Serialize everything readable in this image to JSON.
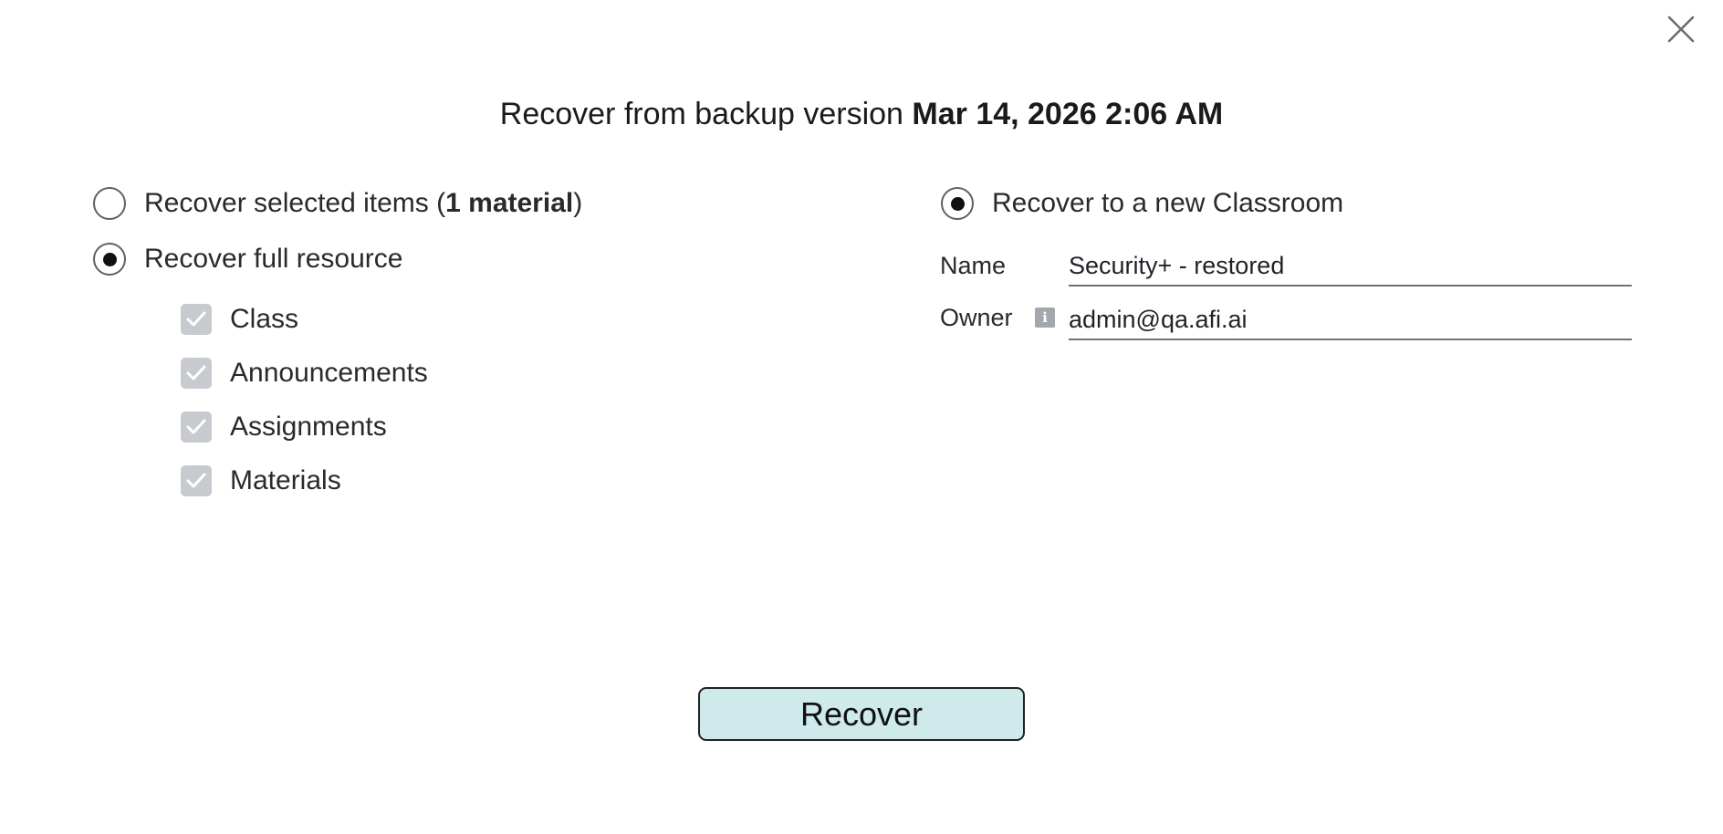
{
  "dialog": {
    "title_prefix": "Recover from backup version ",
    "title_date": "Mar 14, 2026 2:06 AM",
    "close_icon": "close-icon"
  },
  "scope": {
    "selected_items": {
      "label_prefix": "Recover selected items (",
      "label_bold": "1 material",
      "label_suffix": ")",
      "checked": false
    },
    "full_resource": {
      "label": "Recover full resource",
      "checked": true
    },
    "components": [
      {
        "label": "Class",
        "checked": true,
        "disabled": true
      },
      {
        "label": "Announcements",
        "checked": true,
        "disabled": true
      },
      {
        "label": "Assignments",
        "checked": true,
        "disabled": true
      },
      {
        "label": "Materials",
        "checked": true,
        "disabled": true
      }
    ]
  },
  "destination": {
    "new_classroom": {
      "label": "Recover to a new Classroom",
      "checked": true
    },
    "name": {
      "label": "Name",
      "value": "Security+ - restored"
    },
    "owner": {
      "label": "Owner",
      "info_icon": "info-icon",
      "value": "admin@qa.afi.ai"
    }
  },
  "actions": {
    "recover_label": "Recover",
    "recover_color": "#cfeaea"
  }
}
